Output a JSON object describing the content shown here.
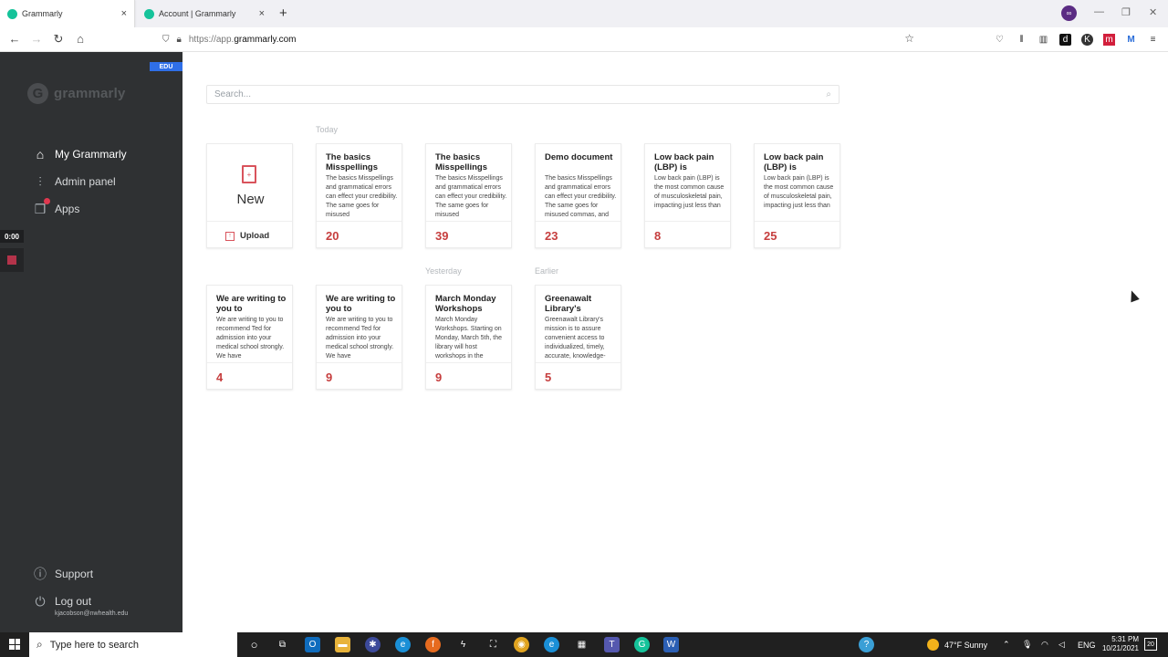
{
  "browser": {
    "tabs": [
      {
        "title": "Grammarly",
        "close": "×"
      },
      {
        "title": "Account | Grammarly",
        "close": "×"
      }
    ],
    "new_tab": "+",
    "url_prefix": "https://app.",
    "url_domain": "grammarly.com",
    "profile": "∞",
    "extensions": [
      "d",
      "K",
      "m",
      "M"
    ]
  },
  "sidebar": {
    "edu_badge": "EDU",
    "logo_text": "grammarly",
    "items": [
      {
        "label": "My Grammarly",
        "icon": "home-icon"
      },
      {
        "label": "Admin panel",
        "icon": "sliders-icon"
      },
      {
        "label": "Apps",
        "icon": "box-icon"
      }
    ],
    "recorder_time": "0:00",
    "support_label": "Support",
    "logout_label": "Log out",
    "user_email": "kjacobson@nwhealth.edu"
  },
  "search": {
    "placeholder": "Search..."
  },
  "sections": {
    "today": "Today",
    "yesterday": "Yesterday",
    "earlier": "Earlier"
  },
  "new_card": {
    "new_label": "New",
    "upload_label": "Upload"
  },
  "documents": [
    {
      "title": "The basics Misspellings",
      "excerpt": "The basics Misspellings and grammatical errors can effect your credibility. The same goes for misused",
      "count": "20"
    },
    {
      "title": "The basics Misspellings",
      "excerpt": "The basics Misspellings and grammatical errors can effect your credibility. The same goes for misused",
      "count": "39"
    },
    {
      "title": "Demo document",
      "excerpt": "The basics Misspellings and grammatical errors can effect your credibility. The same goes for misused commas, and other",
      "count": "23"
    },
    {
      "title": "Low back pain (LBP) is",
      "excerpt": "Low back pain (LBP) is the most common cause of musculoskeletal pain, impacting just less than",
      "count": "8"
    },
    {
      "title": "Low back pain (LBP) is",
      "excerpt": "Low back pain (LBP) is the most common cause of musculoskeletal pain, impacting just less than",
      "count": "25"
    },
    {
      "title": "We are writing to you to",
      "excerpt": "We are writing to you to recommend Ted for admission into your medical school strongly. We have",
      "count": "4"
    },
    {
      "title": "We are writing to you to",
      "excerpt": "We are writing to you to recommend Ted for admission into your medical school strongly. We have",
      "count": "9"
    },
    {
      "title": "March Monday Workshops",
      "excerpt": "March Monday Workshops. Starting on Monday, March 5th, the library will host workshops in the",
      "count": "9"
    },
    {
      "title": "Greenawalt Library's",
      "excerpt": "Greenawalt Library's mission is to assure convenient access to individualized, timely, accurate, knowledge-",
      "count": "5"
    }
  ],
  "taskbar": {
    "search_placeholder": "Type here to search",
    "weather": "47°F  Sunny",
    "language": "ENG",
    "time": "5:31 PM",
    "date": "10/21/2021",
    "notifications": "20"
  },
  "colors": {
    "accent": "#15c39a",
    "count": "#c63e3e",
    "sidebar": "#2f3133",
    "edu": "#2f6fe8"
  }
}
